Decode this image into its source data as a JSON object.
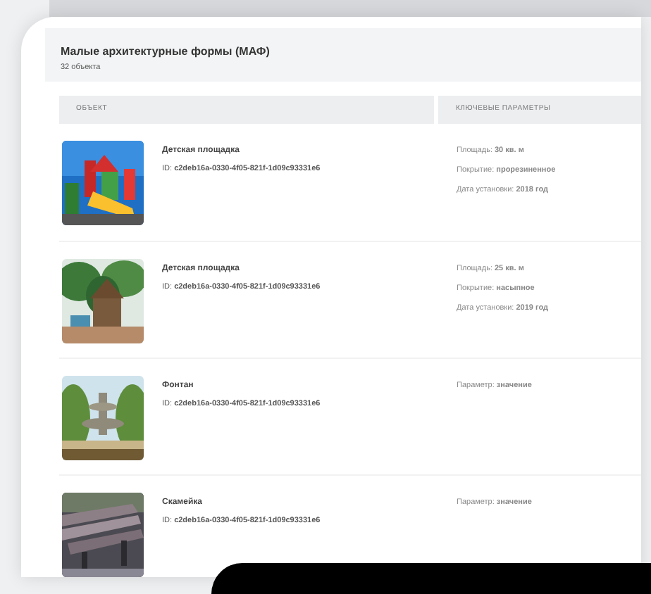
{
  "section": {
    "title": "Малые архитектурные формы (МАФ)",
    "subtitle": "32 объекта"
  },
  "table": {
    "columns": [
      "ОБЪЕКТ",
      "КЛЮЧЕВЫЕ ПАРАМЕТРЫ"
    ],
    "rows": [
      {
        "kind": "picture",
        "name": "Детская площадка",
        "id": "ID: **c2deb16a-0330-4f05-821f-1d09c93331e6**",
        "params": [
          "Площадь: **30 кв. м**",
          "Покрытие: **прорезиненное**",
          "Дата установки: **2018 год**"
        ]
      },
      {
        "kind": "picture",
        "name": "Детская площадка",
        "id": "ID: **c2deb16a-0330-4f05-821f-1d09c93331e6**",
        "params": [
          "Площадь: **25 кв. м**",
          "Покрытие: **насыпное**",
          "Дата установки: **2019 год**"
        ]
      },
      {
        "kind": "picture",
        "name": "Фонтан",
        "id": "ID: **c2deb16a-0330-4f05-821f-1d09c93331e6**",
        "params": [
          "Параметр: **значение**"
        ]
      },
      {
        "kind": "picture",
        "name": "Скамейка",
        "id": "ID: **c2deb16a-0330-4f05-821f-1d09c93331e6**",
        "params": [
          "Параметр: **значение**"
        ]
      }
    ]
  }
}
